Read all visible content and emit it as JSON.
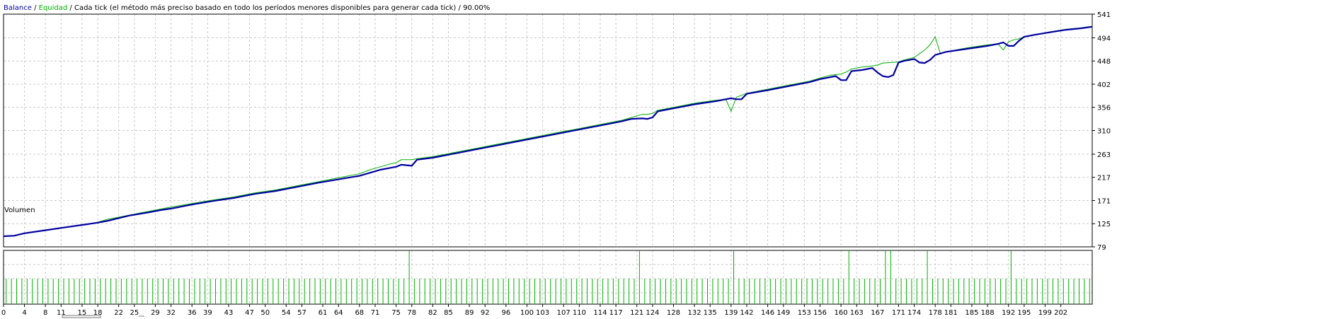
{
  "chart_data": {
    "type": "line",
    "legend": {
      "balance_label": "Balance",
      "sep1": " / ",
      "equity_label": "Equidad",
      "sep2": " / ",
      "model_label": "Cada tick (el método más preciso basado en todo los períodos menores disponibles para generar cada tick)",
      "sep3": "  / ",
      "quality_label": "90.00%"
    },
    "volume_label": "Volumen",
    "colors": {
      "balance": "#0000a0",
      "equity": "#00b000",
      "volume": "#00b000",
      "grid": "#c8c8c8",
      "frame": "#000000"
    },
    "grid": true,
    "xlim": [
      0,
      208
    ],
    "ylim": [
      79,
      541
    ],
    "y_ticks": [
      79,
      125,
      171,
      217,
      263,
      310,
      356,
      402,
      448,
      494,
      541
    ],
    "x_ticks": [
      0,
      4,
      8,
      11,
      15,
      18,
      22,
      25,
      29,
      32,
      36,
      39,
      43,
      47,
      50,
      54,
      57,
      61,
      64,
      68,
      71,
      75,
      78,
      82,
      85,
      89,
      92,
      96,
      100,
      103,
      107,
      110,
      114,
      117,
      121,
      124,
      128,
      132,
      135,
      139,
      142,
      146,
      149,
      153,
      156,
      160,
      163,
      167,
      171,
      174,
      178,
      181,
      185,
      188,
      192,
      195,
      199,
      202
    ],
    "series": [
      {
        "name": "Balance",
        "points": [
          [
            0,
            100
          ],
          [
            2,
            101
          ],
          [
            4,
            106
          ],
          [
            8,
            112
          ],
          [
            12,
            118
          ],
          [
            16,
            124
          ],
          [
            18,
            127
          ],
          [
            20,
            131
          ],
          [
            22,
            136
          ],
          [
            24,
            141
          ],
          [
            28,
            148
          ],
          [
            30,
            152
          ],
          [
            32,
            155
          ],
          [
            36,
            163
          ],
          [
            40,
            170
          ],
          [
            44,
            176
          ],
          [
            48,
            184
          ],
          [
            52,
            190
          ],
          [
            56,
            198
          ],
          [
            60,
            206
          ],
          [
            64,
            213
          ],
          [
            68,
            220
          ],
          [
            70,
            226
          ],
          [
            72,
            232
          ],
          [
            74,
            236
          ],
          [
            75,
            238
          ],
          [
            76,
            242
          ],
          [
            77,
            241
          ],
          [
            78,
            240
          ],
          [
            79,
            252
          ],
          [
            82,
            256
          ],
          [
            86,
            264
          ],
          [
            90,
            272
          ],
          [
            94,
            280
          ],
          [
            98,
            288
          ],
          [
            102,
            296
          ],
          [
            106,
            304
          ],
          [
            110,
            312
          ],
          [
            114,
            320
          ],
          [
            118,
            328
          ],
          [
            120,
            333
          ],
          [
            122,
            334
          ],
          [
            123,
            333
          ],
          [
            124,
            336
          ],
          [
            125,
            348
          ],
          [
            128,
            354
          ],
          [
            132,
            362
          ],
          [
            136,
            368
          ],
          [
            139,
            374
          ],
          [
            140,
            372
          ],
          [
            141,
            372
          ],
          [
            142,
            383
          ],
          [
            146,
            390
          ],
          [
            150,
            398
          ],
          [
            154,
            406
          ],
          [
            156,
            412
          ],
          [
            158,
            416
          ],
          [
            159,
            418
          ],
          [
            160,
            410
          ],
          [
            161,
            410
          ],
          [
            162,
            428
          ],
          [
            164,
            430
          ],
          [
            166,
            434
          ],
          [
            167,
            425
          ],
          [
            168,
            418
          ],
          [
            169,
            416
          ],
          [
            170,
            420
          ],
          [
            171,
            445
          ],
          [
            172,
            448
          ],
          [
            174,
            452
          ],
          [
            175,
            445
          ],
          [
            176,
            444
          ],
          [
            177,
            450
          ],
          [
            178,
            460
          ],
          [
            180,
            466
          ],
          [
            184,
            472
          ],
          [
            188,
            478
          ],
          [
            190,
            482
          ],
          [
            191,
            485
          ],
          [
            192,
            478
          ],
          [
            193,
            478
          ],
          [
            194,
            488
          ],
          [
            195,
            496
          ],
          [
            197,
            500
          ],
          [
            200,
            505
          ],
          [
            203,
            510
          ],
          [
            206,
            513
          ],
          [
            208,
            516
          ]
        ]
      },
      {
        "name": "Equidad",
        "points": [
          [
            0,
            100
          ],
          [
            2,
            101
          ],
          [
            4,
            106
          ],
          [
            8,
            112
          ],
          [
            12,
            118
          ],
          [
            16,
            124
          ],
          [
            18,
            128
          ],
          [
            20,
            134
          ],
          [
            22,
            138
          ],
          [
            24,
            142
          ],
          [
            28,
            150
          ],
          [
            30,
            154
          ],
          [
            32,
            158
          ],
          [
            36,
            165
          ],
          [
            40,
            172
          ],
          [
            44,
            178
          ],
          [
            48,
            186
          ],
          [
            52,
            192
          ],
          [
            56,
            200
          ],
          [
            60,
            208
          ],
          [
            64,
            216
          ],
          [
            68,
            224
          ],
          [
            70,
            232
          ],
          [
            72,
            238
          ],
          [
            74,
            244
          ],
          [
            75,
            246
          ],
          [
            76,
            252
          ],
          [
            77,
            252
          ],
          [
            78,
            252
          ],
          [
            79,
            254
          ],
          [
            82,
            258
          ],
          [
            86,
            266
          ],
          [
            90,
            274
          ],
          [
            94,
            282
          ],
          [
            98,
            290
          ],
          [
            102,
            298
          ],
          [
            106,
            306
          ],
          [
            110,
            314
          ],
          [
            114,
            322
          ],
          [
            118,
            330
          ],
          [
            120,
            336
          ],
          [
            122,
            342
          ],
          [
            123,
            342
          ],
          [
            124,
            344
          ],
          [
            125,
            350
          ],
          [
            128,
            356
          ],
          [
            132,
            364
          ],
          [
            136,
            370
          ],
          [
            138,
            372
          ],
          [
            139,
            348
          ],
          [
            140,
            376
          ],
          [
            141,
            380
          ],
          [
            142,
            384
          ],
          [
            146,
            392
          ],
          [
            150,
            400
          ],
          [
            154,
            408
          ],
          [
            156,
            414
          ],
          [
            158,
            420
          ],
          [
            160,
            422
          ],
          [
            161,
            426
          ],
          [
            162,
            432
          ],
          [
            164,
            436
          ],
          [
            166,
            438
          ],
          [
            167,
            440
          ],
          [
            168,
            444
          ],
          [
            171,
            446
          ],
          [
            172,
            450
          ],
          [
            174,
            455
          ],
          [
            176,
            470
          ],
          [
            177,
            480
          ],
          [
            178,
            496
          ],
          [
            179,
            462
          ],
          [
            180,
            466
          ],
          [
            184,
            474
          ],
          [
            188,
            480
          ],
          [
            190,
            482
          ],
          [
            191,
            470
          ],
          [
            192,
            486
          ],
          [
            193,
            490
          ],
          [
            194,
            492
          ],
          [
            195,
            496
          ],
          [
            197,
            500
          ],
          [
            200,
            506
          ],
          [
            203,
            511
          ],
          [
            206,
            514
          ],
          [
            208,
            517
          ]
        ]
      }
    ],
    "volume": {
      "count": 208,
      "base": 1,
      "spikes": [
        [
          78,
          2
        ],
        [
          122,
          2
        ],
        [
          140,
          2
        ],
        [
          162,
          2
        ],
        [
          169,
          2
        ],
        [
          170,
          2
        ],
        [
          177,
          2
        ],
        [
          193,
          2
        ]
      ]
    }
  }
}
